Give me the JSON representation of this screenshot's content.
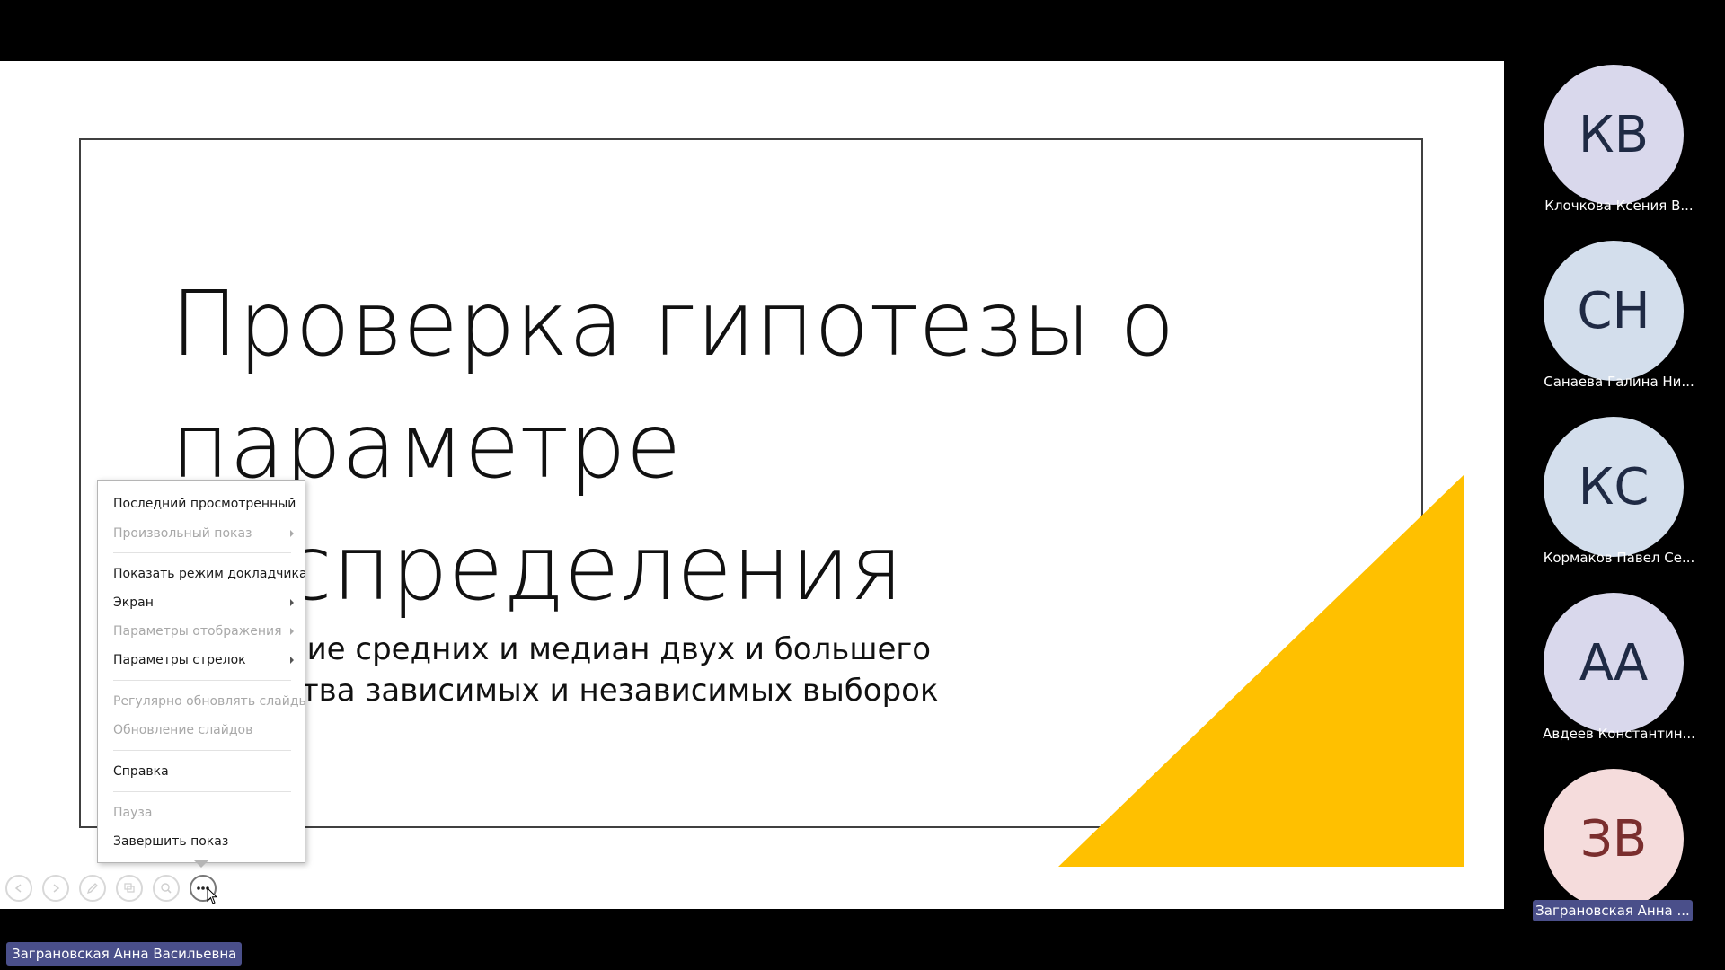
{
  "slide": {
    "title": "Проверка гипотезы о\nпараметре\nраспределения",
    "subtitle": "Сравнение средних и медиан двух и большего\nколичества зависимых и независимых выборок",
    "accent_color": "#FFC000"
  },
  "context_menu": {
    "items": [
      {
        "label": "Последний просмотренный",
        "disabled": false,
        "submenu": false
      },
      {
        "label": "Произвольный показ",
        "disabled": true,
        "submenu": true
      },
      {
        "label": "Показать режим докладчика",
        "disabled": false,
        "submenu": false
      },
      {
        "label": "Экран",
        "disabled": false,
        "submenu": true
      },
      {
        "label": "Параметры отображения",
        "disabled": true,
        "submenu": true
      },
      {
        "label": "Параметры стрелок",
        "disabled": false,
        "submenu": true
      },
      {
        "label": "Регулярно обновлять слайды",
        "disabled": true,
        "submenu": false
      },
      {
        "label": "Обновление слайдов",
        "disabled": true,
        "submenu": false
      },
      {
        "label": "Справка",
        "disabled": false,
        "submenu": false
      },
      {
        "label": "Пауза",
        "disabled": true,
        "submenu": false
      },
      {
        "label": "Завершить показ",
        "disabled": false,
        "submenu": false
      }
    ]
  },
  "toolbar": {
    "buttons": [
      {
        "icon": "previous-slide-icon"
      },
      {
        "icon": "next-slide-icon"
      },
      {
        "icon": "pen-icon"
      },
      {
        "icon": "see-all-slides-icon"
      },
      {
        "icon": "zoom-icon"
      },
      {
        "icon": "more-options-icon"
      }
    ]
  },
  "participants": [
    {
      "initials": "КВ",
      "name": "Клочкова Ксения В...",
      "bg": "#D9D8EC",
      "fg": "#1F2A44"
    },
    {
      "initials": "СН",
      "name": "Санаева Галина Ни...",
      "bg": "#D3DEEC",
      "fg": "#1F2A44"
    },
    {
      "initials": "КС",
      "name": "Кормаков Павел Се...",
      "bg": "#D3DEEC",
      "fg": "#1F2A44"
    },
    {
      "initials": "АА",
      "name": "Авдеев Константин...",
      "bg": "#D9D8EC",
      "fg": "#1F2A44"
    },
    {
      "initials": "ЗВ",
      "name": "Заграновская Анна ...",
      "bg": "#F5DCDC",
      "fg": "#7A2E2E"
    }
  ],
  "speaker_label": "Заграновская Анна Васильевна"
}
